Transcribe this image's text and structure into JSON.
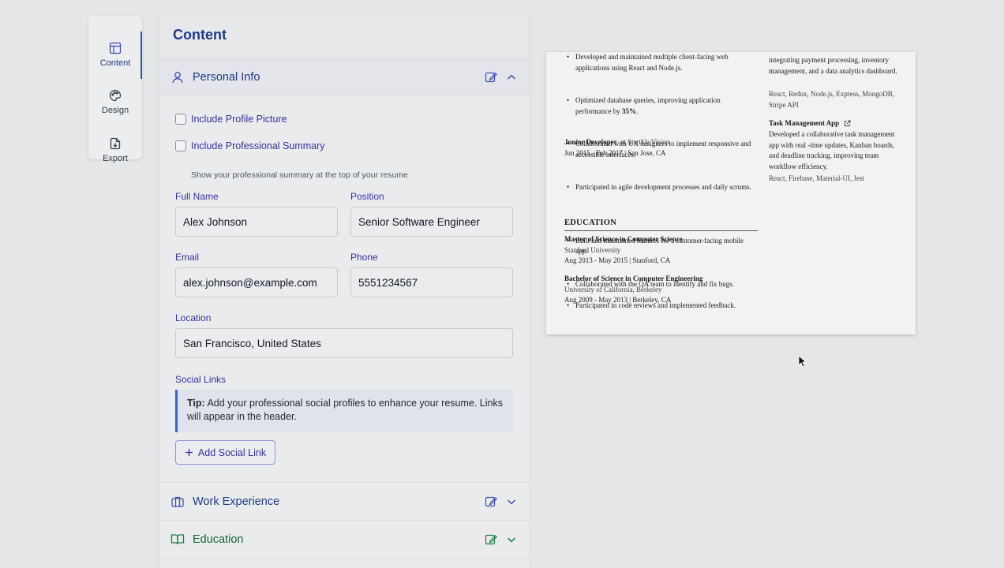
{
  "rail": {
    "items": [
      {
        "label": "Content"
      },
      {
        "label": "Design"
      },
      {
        "label": "Export"
      }
    ]
  },
  "panel": {
    "title": "Content"
  },
  "personal": {
    "title": "Personal Info",
    "include_picture": "Include Profile Picture",
    "include_summary": "Include Professional Summary",
    "summary_hint": "Show your professional summary at the top of your resume",
    "full_name_label": "Full Name",
    "full_name": "Alex Johnson",
    "position_label": "Position",
    "position": "Senior Software Engineer",
    "email_label": "Email",
    "email": "alex.johnson@example.com",
    "phone_label": "Phone",
    "phone": "5551234567",
    "location_label": "Location",
    "location": "San Francisco, United States",
    "social_label": "Social Links",
    "tip_bold": "Tip:",
    "tip_text": " Add your professional social profiles to enhance your resume. Links will appear in the header.",
    "add_social": "Add Social Link"
  },
  "sections": {
    "work": "Work Experience",
    "education": "Education"
  },
  "resume": {
    "job1_bullets": [
      "Developed and maintained multiple client-facing web applications using React and Node.js.",
      "Optimized database queries, improving application performance by ",
      "Collaborated with UX designers to implement responsive and accessible interfaces.",
      "Participated in agile development processes and daily scrums."
    ],
    "job1_percent": "35%",
    "job1_period": ".",
    "job2_title": "Junior Developer",
    "job2_company": "at StartUp Vision",
    "job2_dates": "Jun 2015 - Feb 2017 | San Jose, CA",
    "job2_bullets": [
      "Built and maintained features for a customer-facing mobile app.",
      "Collaborated with the QA team to identify and fix bugs.",
      "Participated in code reviews and implemented feedback."
    ],
    "education_heading": "EDUCATION",
    "edu1_degree": "Master of Science in Computer Science",
    "edu1_school": "Stanford University",
    "edu1_dates": "Aug 2013 - May 2015 | Stanford, CA",
    "edu2_degree": "Bachelor of Science in Computer Engineering",
    "edu2_school": "University of California, Berkeley",
    "edu2_dates": "Aug 2009 - May 2013 | Berkeley, CA",
    "proj1_desc_tail": "integrating payment processing, inventory management, and a data analytics dashboard.",
    "proj1_tech": "React, Redux, Node.js, Express, MongoDB, Stripe API",
    "proj2_title": "Task Management App",
    "proj2_desc": "Developed a collaborative task management app with real -time updates, Kanban boards, and deadline tracking, improving team workflow efficiency.",
    "proj2_tech": "React, Firebase, Material-UI, Jest"
  },
  "colors": {
    "accent": "#1e3a8a",
    "label": "#3730a3",
    "education_icon": "#166534"
  }
}
